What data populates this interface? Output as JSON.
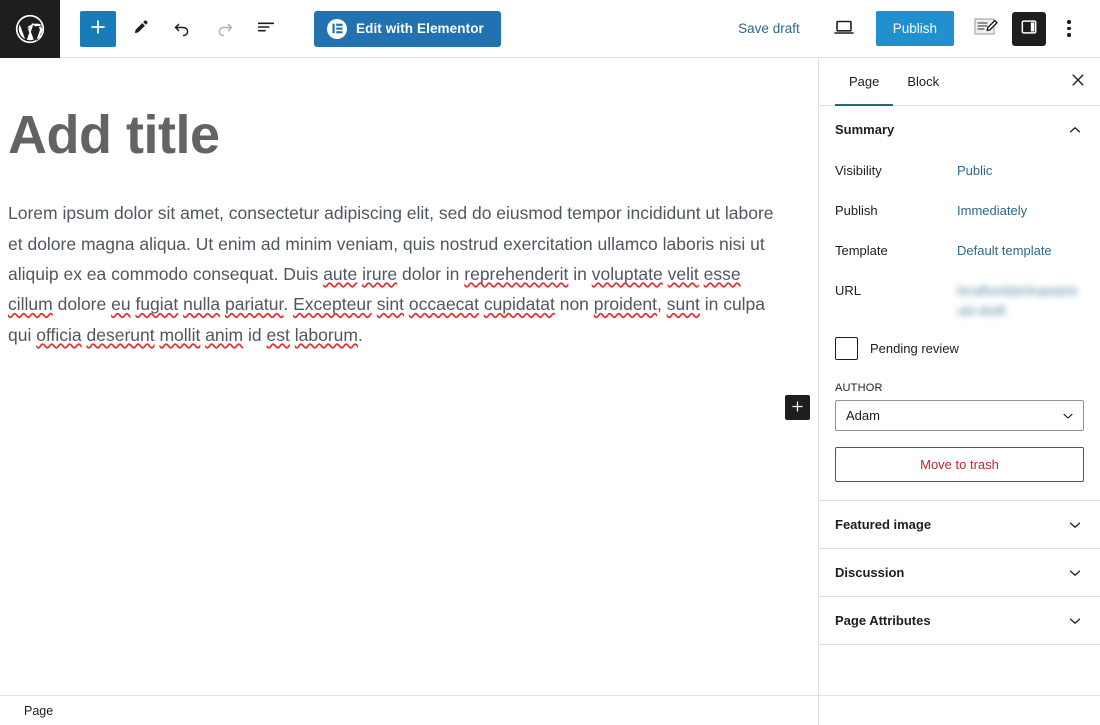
{
  "toolbar": {
    "logo_icon": "wordpress-logo-icon",
    "add_block_label": "+",
    "add_block_icon": "plus-icon",
    "tools_icon": "pencil-icon",
    "undo_icon": "undo-arrow-icon",
    "redo_icon": "redo-arrow-icon",
    "list_view_icon": "document-overview-icon",
    "elementor_label": "Edit with Elementor",
    "elementor_icon": "elementor-logo-icon",
    "save_draft_label": "Save draft",
    "preview_icon": "laptop-preview-icon",
    "publish_label": "Publish",
    "plugin_icon": "yoast-seo-edit-icon",
    "sidebar_toggle_icon": "sidebar-panel-icon",
    "more_options_icon": "three-dots-vertical-icon"
  },
  "editor": {
    "title_placeholder": "Add title",
    "paragraph_segments": [
      {
        "text": "Lorem ipsum dolor sit amet, consectetur adipiscing elit, sed do eiusmod tempor incididunt ut labore et dolore magna aliqua. Ut enim ad minim veniam, quis nostrud exercitation ullamco laboris nisi ut aliquip ex ea commodo consequat. Duis ",
        "misspelled": false
      },
      {
        "text": "aute",
        "misspelled": true
      },
      {
        "text": " ",
        "misspelled": false
      },
      {
        "text": "irure",
        "misspelled": true
      },
      {
        "text": " dolor in ",
        "misspelled": false
      },
      {
        "text": "reprehenderit",
        "misspelled": true
      },
      {
        "text": " in ",
        "misspelled": false
      },
      {
        "text": "voluptate",
        "misspelled": true
      },
      {
        "text": " ",
        "misspelled": false
      },
      {
        "text": "velit",
        "misspelled": true
      },
      {
        "text": " ",
        "misspelled": false
      },
      {
        "text": "esse",
        "misspelled": true
      },
      {
        "text": " ",
        "misspelled": false
      },
      {
        "text": "cillum",
        "misspelled": true
      },
      {
        "text": " dolore ",
        "misspelled": false
      },
      {
        "text": "eu",
        "misspelled": true
      },
      {
        "text": " ",
        "misspelled": false
      },
      {
        "text": "fugiat",
        "misspelled": true
      },
      {
        "text": " ",
        "misspelled": false
      },
      {
        "text": "nulla",
        "misspelled": true
      },
      {
        "text": " ",
        "misspelled": false
      },
      {
        "text": "pariatur",
        "misspelled": true
      },
      {
        "text": ". ",
        "misspelled": false
      },
      {
        "text": "Excepteur",
        "misspelled": true
      },
      {
        "text": " ",
        "misspelled": false
      },
      {
        "text": "sint",
        "misspelled": true
      },
      {
        "text": " ",
        "misspelled": false
      },
      {
        "text": "occaecat",
        "misspelled": true
      },
      {
        "text": " ",
        "misspelled": false
      },
      {
        "text": "cupidatat",
        "misspelled": true
      },
      {
        "text": " non ",
        "misspelled": false
      },
      {
        "text": "proident",
        "misspelled": true
      },
      {
        "text": ", ",
        "misspelled": false
      },
      {
        "text": "sunt",
        "misspelled": true
      },
      {
        "text": " in culpa qui ",
        "misspelled": false
      },
      {
        "text": "officia",
        "misspelled": true
      },
      {
        "text": " ",
        "misspelled": false
      },
      {
        "text": "deserunt",
        "misspelled": true
      },
      {
        "text": " ",
        "misspelled": false
      },
      {
        "text": "mollit",
        "misspelled": true
      },
      {
        "text": " ",
        "misspelled": false
      },
      {
        "text": "anim",
        "misspelled": true
      },
      {
        "text": " id ",
        "misspelled": false
      },
      {
        "text": "est",
        "misspelled": true
      },
      {
        "text": " ",
        "misspelled": false
      },
      {
        "text": "laborum",
        "misspelled": true
      },
      {
        "text": ".",
        "misspelled": false
      }
    ],
    "block_appender_icon": "plus-icon"
  },
  "sidebar": {
    "tabs": [
      {
        "label": "Page",
        "active": true
      },
      {
        "label": "Block",
        "active": false
      }
    ],
    "close_icon": "close-x-icon",
    "panels": [
      {
        "label": "Summary",
        "expanded": true,
        "chevron_icon": "chevron-up-icon"
      },
      {
        "label": "Featured image",
        "expanded": false,
        "chevron_icon": "chevron-down-icon"
      },
      {
        "label": "Discussion",
        "expanded": false,
        "chevron_icon": "chevron-down-icon"
      },
      {
        "label": "Page Attributes",
        "expanded": false,
        "chevron_icon": "chevron-down-icon"
      }
    ],
    "summary": {
      "visibility_label": "Visibility",
      "visibility_value": "Public",
      "publish_label": "Publish",
      "publish_value": "Immediately",
      "template_label": "Template",
      "template_value": "Default template",
      "url_label": "URL",
      "url_value": "localhost/pickupwp/auto-draft",
      "pending_review_label": "Pending review",
      "pending_review_checked": false,
      "author_label": "AUTHOR",
      "author_value": "Adam",
      "author_chevron_icon": "chevron-down-icon",
      "trash_label": "Move to trash"
    }
  },
  "statusbar": {
    "label": "Page"
  },
  "colors": {
    "wp_admin_dark": "#1e1e1e",
    "publish_blue": "#2190cf",
    "elementor_blue": "#2271b1",
    "link_blue": "#2d6a8a",
    "trash_red": "#b32d2e",
    "spellcheck_red": "#e03030",
    "border_gray": "#e0e0e0"
  }
}
